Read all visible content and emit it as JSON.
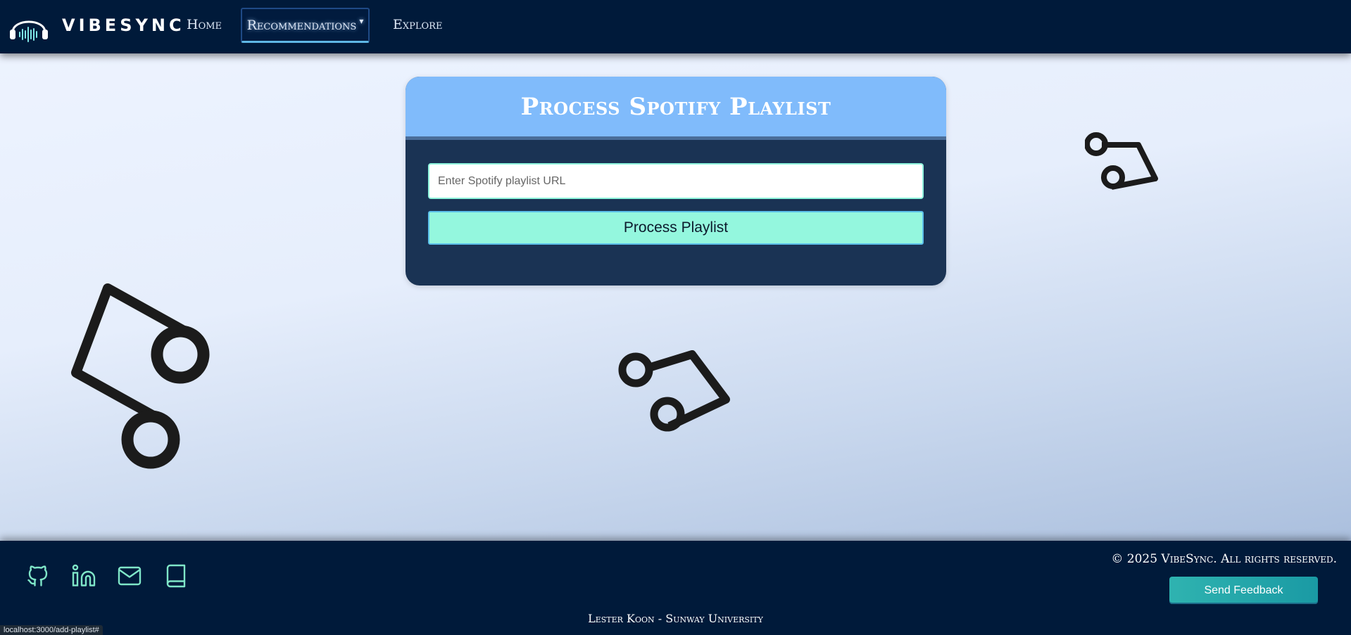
{
  "nav": {
    "brand": "VIBESYNC",
    "items": [
      {
        "label": "Home"
      },
      {
        "label": "Recommendations",
        "caret": "▾"
      },
      {
        "label": "Explore"
      }
    ]
  },
  "card": {
    "title": "Process Spotify Playlist",
    "input_placeholder": "Enter Spotify playlist URL",
    "input_value": "",
    "button_label": "Process Playlist"
  },
  "footer": {
    "social_icons": [
      "github-icon",
      "linkedin-icon",
      "mail-icon",
      "book-icon"
    ],
    "copyright": "© 2025 VibeSync. All rights reserved.",
    "feedback_label": "Send Feedback",
    "credit": "Lester Koon - Sunway University"
  },
  "status_bar": {
    "url": "localhost:3000/add-playlist#"
  },
  "colors": {
    "nav_bg": "#001a3a",
    "card_header": "#80bbfb",
    "card_body": "#1a3354",
    "button_accent": "#94f7de",
    "icon_accent": "#7fe6c8"
  }
}
